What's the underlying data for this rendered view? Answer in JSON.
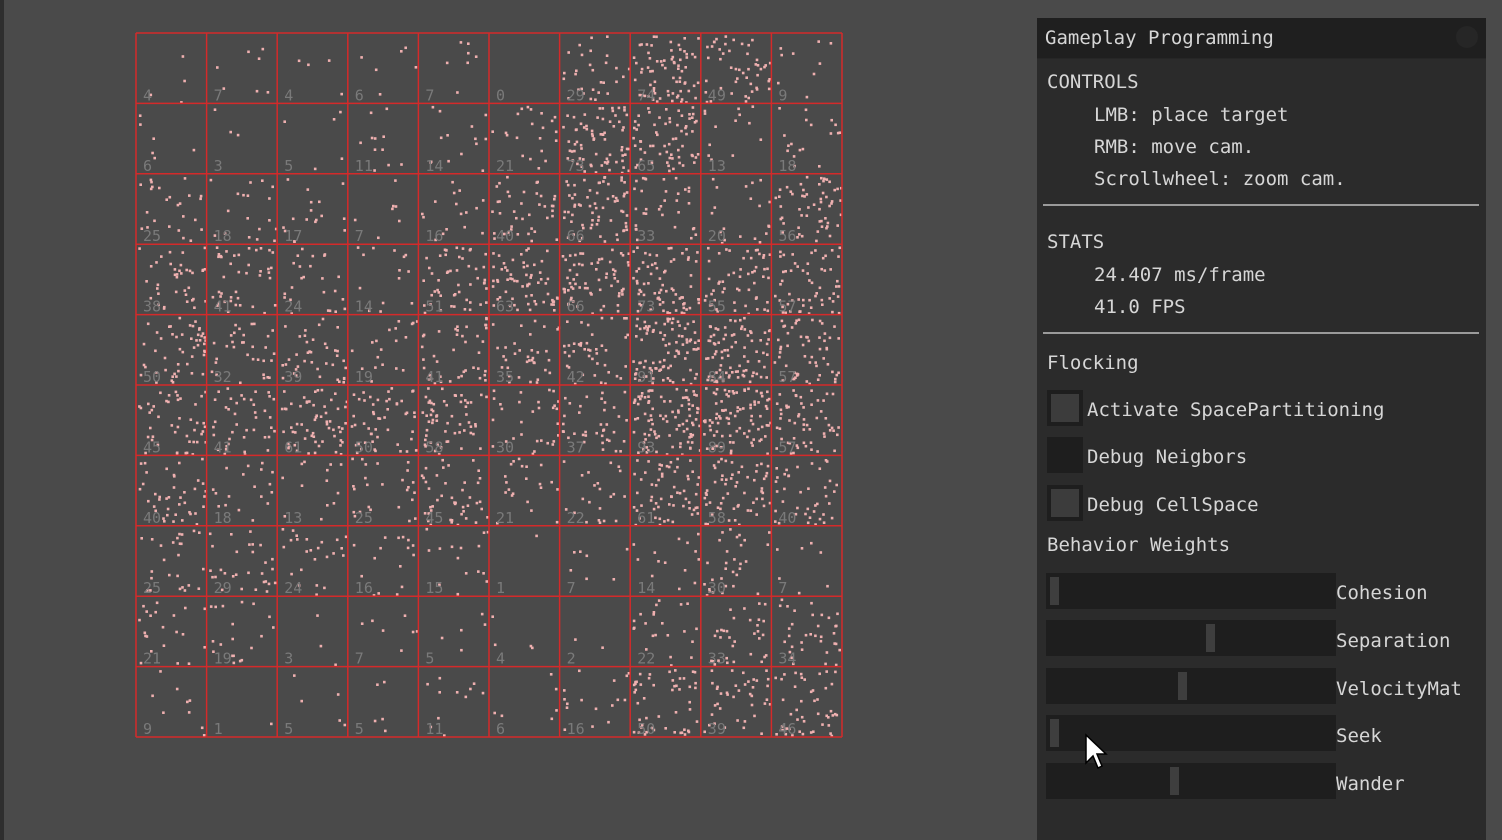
{
  "panel": {
    "title": "Gameplay Programming",
    "controls_header": "CONTROLS",
    "controls": [
      "LMB: place target",
      "RMB: move cam.",
      "Scrollwheel: zoom cam."
    ],
    "stats_header": "STATS",
    "frame_time": "24.407 ms/frame",
    "fps": "41.0 FPS",
    "flocking_header": "Flocking",
    "checkboxes": [
      {
        "label": "Activate SpacePartitioning",
        "checked": false
      },
      {
        "label": "Debug Neigbors",
        "checked": false
      },
      {
        "label": "Debug CellSpace",
        "checked": false
      }
    ],
    "weights_header": "Behavior Weights",
    "sliders": [
      {
        "label": "Cohesion",
        "value": 0.0
      },
      {
        "label": "Separation",
        "value": 0.57
      },
      {
        "label": "VelocityMat",
        "value": 0.47
      },
      {
        "label": "Seek",
        "value": 0.0
      },
      {
        "label": "Wander",
        "value": 0.44
      }
    ]
  },
  "grid": {
    "rows": 10,
    "cols": 10,
    "line_color": "#d42a2a",
    "agent_color": "#efb0b0",
    "cell_counts": [
      [
        4,
        7,
        4,
        6,
        7,
        0,
        29,
        74,
        49,
        9
      ],
      [
        6,
        3,
        5,
        11,
        14,
        21,
        73,
        65,
        13,
        18
      ],
      [
        25,
        18,
        17,
        7,
        16,
        40,
        66,
        33,
        20,
        56
      ],
      [
        38,
        41,
        24,
        14,
        51,
        63,
        66,
        73,
        55,
        57
      ],
      [
        50,
        32,
        39,
        19,
        41,
        35,
        42,
        91,
        84,
        57
      ],
      [
        45,
        41,
        61,
        50,
        58,
        30,
        37,
        93,
        89,
        57
      ],
      [
        40,
        18,
        13,
        25,
        45,
        21,
        22,
        61,
        58,
        40
      ],
      [
        25,
        29,
        24,
        16,
        15,
        1,
        7,
        14,
        30,
        7
      ],
      [
        21,
        19,
        3,
        7,
        5,
        4,
        2,
        22,
        33,
        34
      ],
      [
        9,
        1,
        5,
        5,
        11,
        6,
        16,
        50,
        39,
        46
      ]
    ]
  }
}
